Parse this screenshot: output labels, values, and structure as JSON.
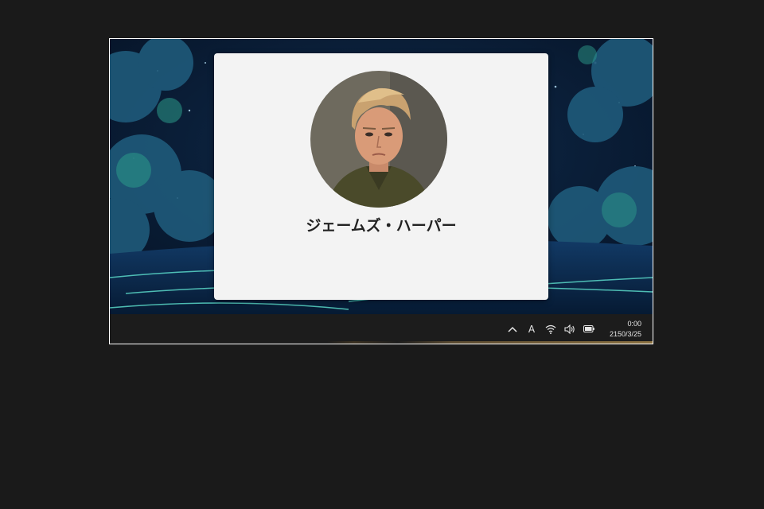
{
  "lock_screen": {
    "user_name": "ジェームズ・ハーパー",
    "avatar_icon": "user-avatar-portrait"
  },
  "taskbar": {
    "tray": {
      "chevron_icon": "chevron-up-icon",
      "ime_label": "A",
      "wifi_icon": "wifi-icon",
      "volume_icon": "speaker-icon",
      "battery_icon": "battery-icon"
    },
    "clock": {
      "time": "0:00",
      "date": "2150/3/25"
    }
  },
  "colors": {
    "card_background": "#f3f3f3",
    "taskbar_background": "#1c1c1c",
    "page_background": "#1a1a1a"
  }
}
